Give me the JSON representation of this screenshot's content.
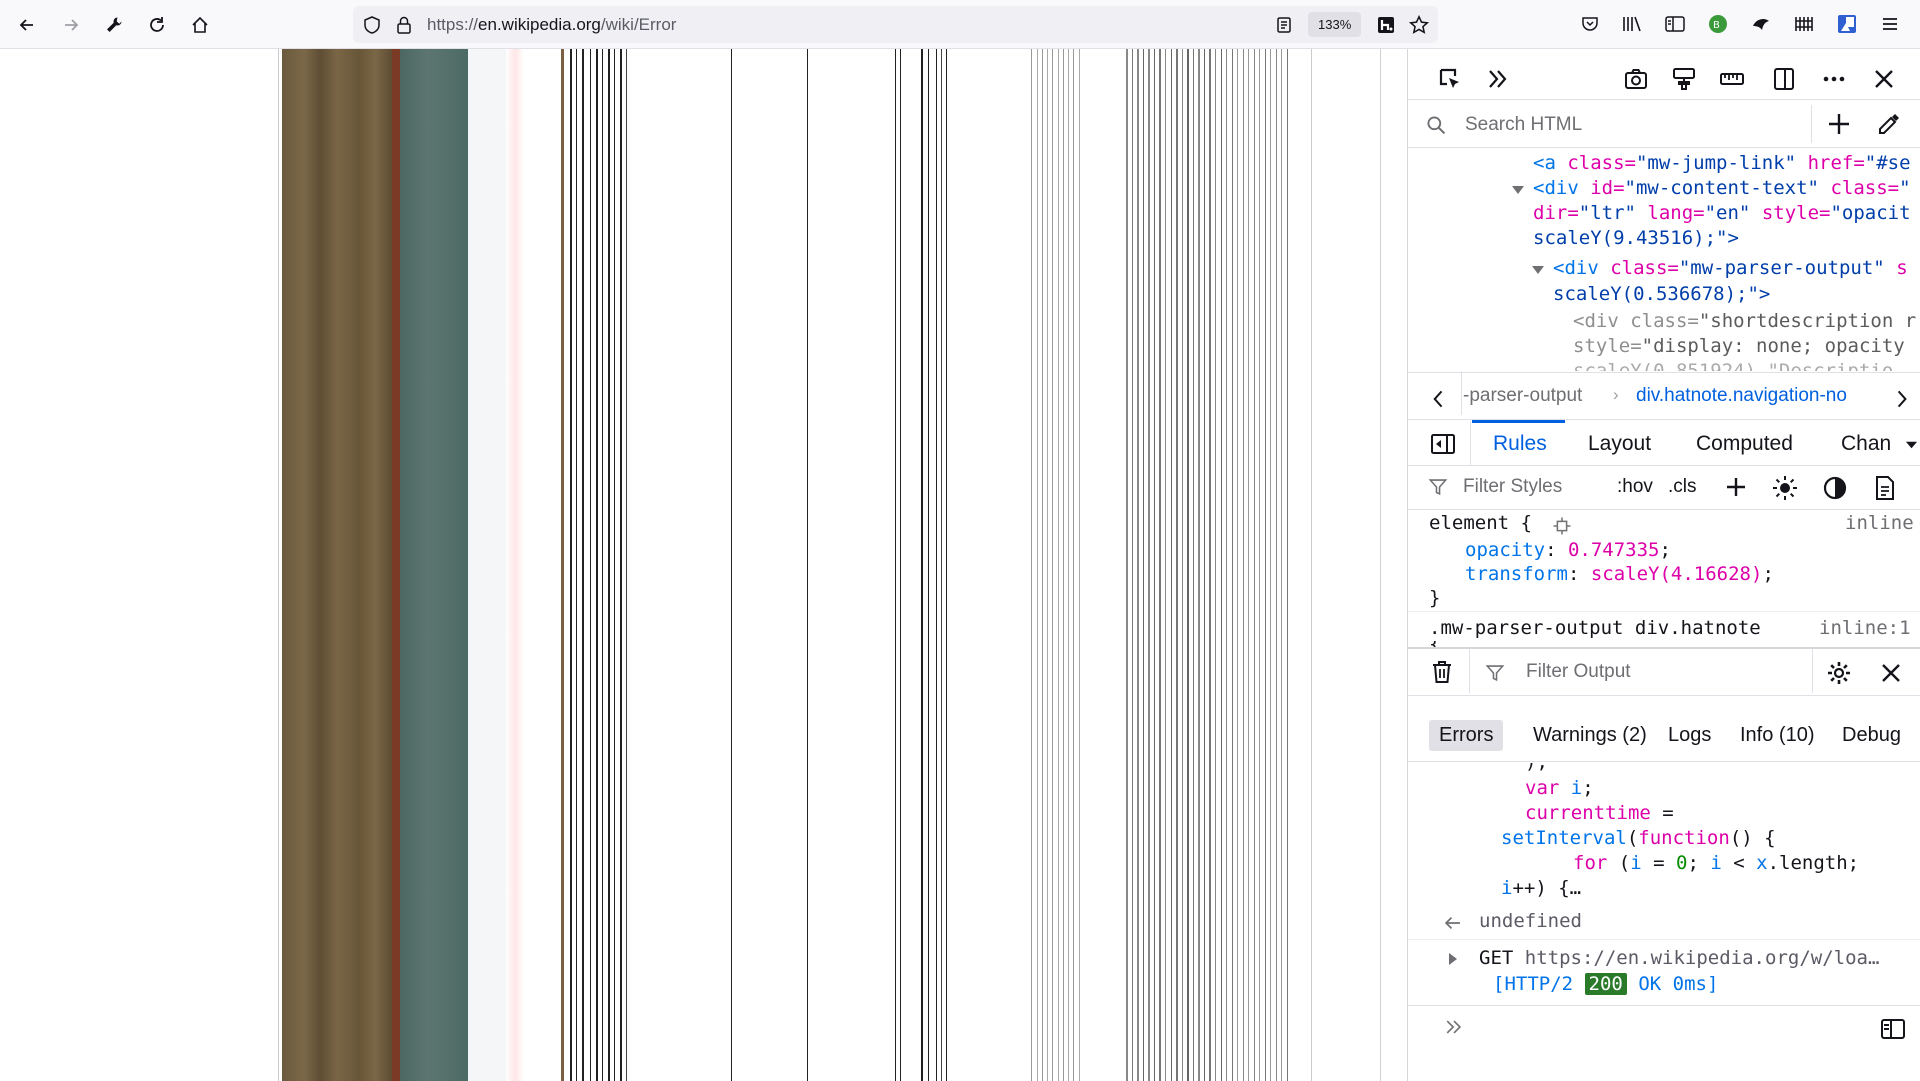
{
  "toolbar": {
    "back_icon": "arrow-left-icon",
    "forward_icon": "arrow-right-icon",
    "tools_icon": "wrench-icon",
    "reload_icon": "reload-icon",
    "home_icon": "home-icon",
    "url_prefix": "https://",
    "url_host": "en.wikipedia.org",
    "url_path": "/wiki/Error",
    "zoom": "133%"
  },
  "devtools": {
    "search_html_placeholder": "Search HTML",
    "markup": {
      "line1": {
        "tag": "<a",
        "a1": " class=",
        "v1": "\"mw-jump-link\"",
        "a2": " href=",
        "v2": "\"#se"
      },
      "line2": {
        "tag": "<div",
        "a1": " id=",
        "v1": "\"mw-content-text\"",
        "a2": " class=",
        "v2": "\""
      },
      "line3": {
        "a1": "dir=",
        "v1": "\"ltr\"",
        "a2": " lang=",
        "v2": "\"en\"",
        "a3": " style=",
        "v3": "\"opacit"
      },
      "line4": {
        "v1": "scaleY(9.43516);\">"
      },
      "line5": {
        "tag": "<div",
        "a1": " class=",
        "v1": "\"mw-parser-output\"",
        "a2": " s"
      },
      "line6": {
        "v1": "scaleY(0.536678);\">"
      },
      "line7": {
        "tag": "<div",
        "a1": " class=",
        "v1": "\"shortdescription r"
      },
      "line8": {
        "a1": "style=",
        "v1": "\"display: none; opacity"
      },
      "line9": {
        "v1": "scaleY(0.851924) \"Descriptio"
      }
    },
    "breadcrumbs": [
      "-parser-output",
      "div.hatnote.navigation-no"
    ],
    "tabs": [
      "Rules",
      "Layout",
      "Computed",
      "Chan"
    ],
    "filter_styles_placeholder": "Filter Styles",
    "hov": ":hov",
    "cls": ".cls",
    "rule": {
      "selector": "element {",
      "source": "inline",
      "decl1_prop": "opacity",
      "decl1_val": "0.747335",
      "decl2_prop": "transform",
      "decl2_val": "scaleY(4.16628)",
      "close": "}",
      "next_selector": ".mw-parser-output div.hatnote",
      "next_source": "inline:1",
      "next_open": "{"
    },
    "console": {
      "filter_output_placeholder": "Filter Output",
      "filters": [
        "Errors",
        "Warnings (2)",
        "Logs",
        "Info (10)",
        "Debug"
      ],
      "code_line0": ");",
      "code_var": "var",
      "code_i": "i",
      "code_semi": ";",
      "code_currenttime": "currenttime",
      "code_eq": " =",
      "code_setInterval": "setInterval",
      "code_function": "function",
      "code_fnrest": "() {",
      "code_for": "for",
      "code_paren": " (",
      "code_i2": "i",
      "code_eq0": " = ",
      "code_zero": "0",
      "code_semi2": "; ",
      "code_i3": "i",
      "code_lt": " < ",
      "code_x": "x",
      "code_length": ".length;",
      "code_ipp": "i",
      "code_ipp_rest": "++) {…",
      "result": "undefined",
      "get_method": "GET",
      "get_url": "https://en.wikipedia.org/w/loa…",
      "get_proto": "[HTTP/2",
      "get_status": "200",
      "get_rest": "OK 0ms]"
    }
  }
}
